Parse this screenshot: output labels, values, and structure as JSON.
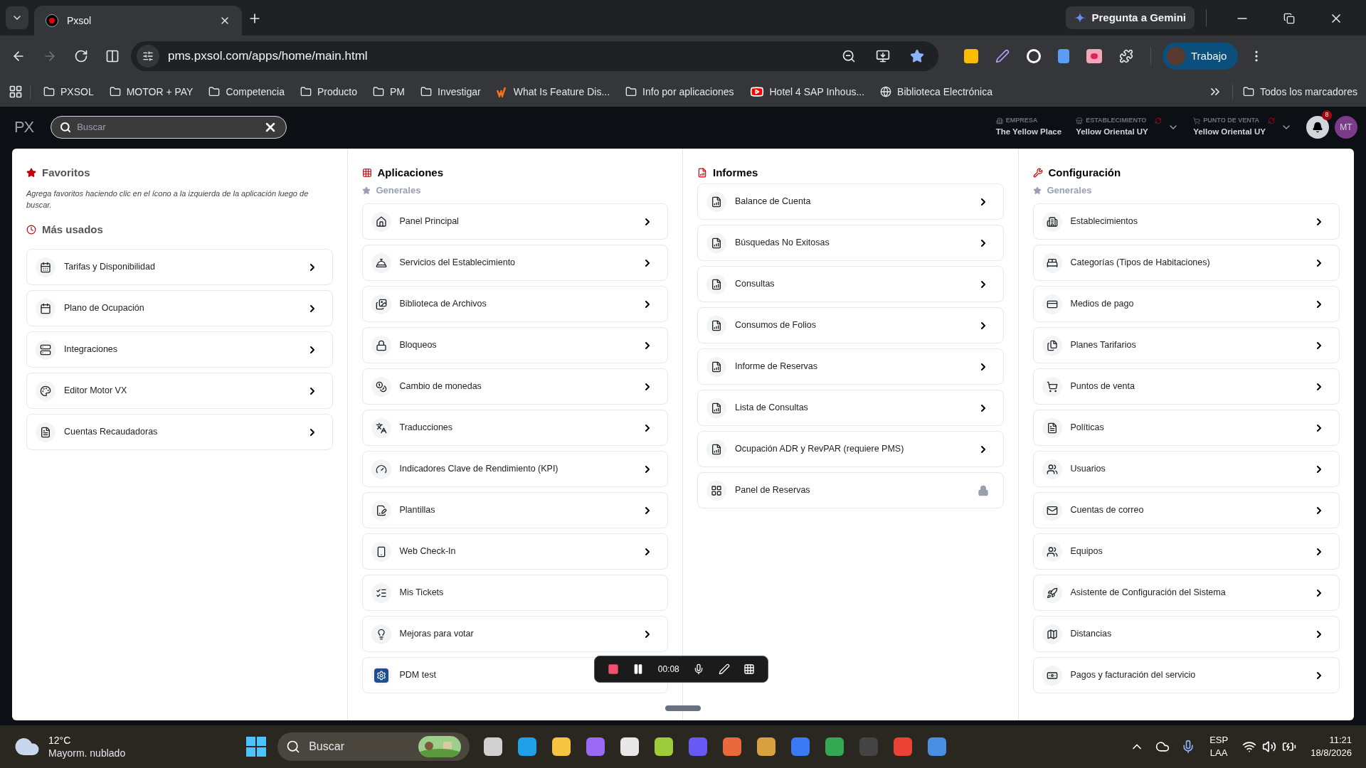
{
  "browser": {
    "tabs": [
      {
        "title": "Pxsol",
        "selected": true
      }
    ],
    "gemini_button": "Pregunta a Gemini",
    "url": "pms.pxsol.com/apps/home/main.html",
    "profile": "Trabajo",
    "bookmarks": [
      {
        "label": "PXSOL",
        "kind": "folder"
      },
      {
        "label": "MOTOR + PAY",
        "kind": "folder"
      },
      {
        "label": "Competencia",
        "kind": "folder"
      },
      {
        "label": "Producto",
        "kind": "folder"
      },
      {
        "label": "PM",
        "kind": "folder"
      },
      {
        "label": "Investigar",
        "kind": "folder"
      },
      {
        "label": "What Is Feature Dis...",
        "kind": "site"
      },
      {
        "label": "Info por aplicaciones",
        "kind": "folder"
      },
      {
        "label": "Hotel 4 SAP Inhous...",
        "kind": "video"
      },
      {
        "label": "Biblioteca Electrónica",
        "kind": "globe"
      }
    ],
    "all_bookmarks": "Todos los marcadores"
  },
  "app_header": {
    "logo": "PX",
    "search": {
      "placeholder": "Buscar"
    },
    "context": [
      {
        "label": "EMPRESA",
        "value": "The Yellow Place",
        "switchable": false
      },
      {
        "label": "ESTABLECIMIENTO",
        "value": "Yellow Oriental UY",
        "switchable": true
      },
      {
        "label": "PUNTO DE VENTA",
        "value": "Yellow Oriental UY",
        "switchable": true
      }
    ],
    "notifications": "8",
    "avatar": "MT"
  },
  "favoritos": {
    "title": "Favoritos",
    "hint": "Agrega favoritos haciendo clic en el ícono a la izquierda de la aplicación luego de buscar.",
    "most_used_title": "Más usados",
    "items": [
      {
        "label": "Tarifas y Disponibilidad",
        "chevron": true,
        "locked": false
      },
      {
        "label": "Plano de Ocupación",
        "chevron": true,
        "locked": false
      },
      {
        "label": "Integraciones",
        "chevron": true,
        "locked": false
      },
      {
        "label": "Editor Motor VX",
        "chevron": true,
        "locked": false
      },
      {
        "label": "Cuentas Recaudadoras",
        "chevron": true,
        "locked": false
      }
    ]
  },
  "aplicaciones": {
    "title": "Aplicaciones",
    "section": "Generales",
    "items": [
      {
        "label": "Panel Principal",
        "chevron": true,
        "locked": false
      },
      {
        "label": "Servicios del Establecimiento",
        "chevron": true,
        "locked": false
      },
      {
        "label": "Biblioteca de Archivos",
        "chevron": true,
        "locked": false
      },
      {
        "label": "Bloqueos",
        "chevron": true,
        "locked": false
      },
      {
        "label": "Cambio de monedas",
        "chevron": true,
        "locked": false
      },
      {
        "label": "Traducciones",
        "chevron": true,
        "locked": false
      },
      {
        "label": "Indicadores Clave de Rendimiento (KPI)",
        "chevron": true,
        "locked": false
      },
      {
        "label": "Plantillas",
        "chevron": true,
        "locked": false
      },
      {
        "label": "Web Check-In",
        "chevron": true,
        "locked": false
      },
      {
        "label": "Mis Tickets",
        "chevron": false,
        "locked": false
      },
      {
        "label": "Mejoras para votar",
        "chevron": true,
        "locked": false
      },
      {
        "label": "PDM test",
        "chevron": false,
        "locked": false
      }
    ]
  },
  "informes": {
    "title": "Informes",
    "items": [
      {
        "label": "Balance de Cuenta",
        "chevron": true,
        "locked": false
      },
      {
        "label": "Búsquedas No Exitosas",
        "chevron": true,
        "locked": false
      },
      {
        "label": "Consultas",
        "chevron": true,
        "locked": false
      },
      {
        "label": "Consumos de Folios",
        "chevron": true,
        "locked": false
      },
      {
        "label": "Informe de Reservas",
        "chevron": true,
        "locked": false
      },
      {
        "label": "Lista de Consultas",
        "chevron": true,
        "locked": false
      },
      {
        "label": "Ocupación ADR y RevPAR (requiere PMS)",
        "chevron": true,
        "locked": false
      },
      {
        "label": "Panel de Reservas",
        "chevron": false,
        "locked": true
      }
    ]
  },
  "configuracion": {
    "title": "Configuración",
    "section": "Generales",
    "items": [
      {
        "label": "Establecimientos",
        "chevron": true,
        "locked": false
      },
      {
        "label": "Categorías (Tipos de Habitaciones)",
        "chevron": true,
        "locked": false
      },
      {
        "label": "Medios de pago",
        "chevron": true,
        "locked": false
      },
      {
        "label": "Planes Tarifarios",
        "chevron": true,
        "locked": false
      },
      {
        "label": "Puntos de venta",
        "chevron": true,
        "locked": false
      },
      {
        "label": "Políticas",
        "chevron": true,
        "locked": false
      },
      {
        "label": "Usuarios",
        "chevron": true,
        "locked": false
      },
      {
        "label": "Cuentas de correo",
        "chevron": true,
        "locked": false
      },
      {
        "label": "Equipos",
        "chevron": true,
        "locked": false
      },
      {
        "label": "Asistente de Configuración del Sistema",
        "chevron": true,
        "locked": false
      },
      {
        "label": "Distancias",
        "chevron": true,
        "locked": false
      },
      {
        "label": "Pagos y facturación del servicio",
        "chevron": true,
        "locked": false
      }
    ]
  },
  "recorder": {
    "time": "00:08",
    "paused": false
  },
  "taskbar": {
    "temperature": "12°C",
    "weather": "Mayorm. nublado",
    "search": {
      "placeholder": "Buscar"
    },
    "language": "ESP",
    "layout": "LAA",
    "time": "11:21",
    "date": "18/8/2026"
  }
}
